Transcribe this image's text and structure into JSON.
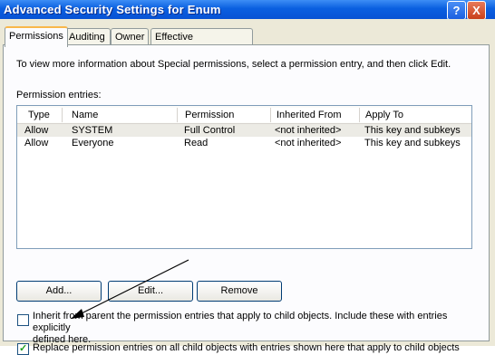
{
  "window": {
    "title": "Advanced Security Settings for Enum",
    "help_label": "?",
    "close_label": "X"
  },
  "tabs": [
    "Permissions",
    "Auditing",
    "Owner",
    "Effective Permissions"
  ],
  "permissions": {
    "info_text": "To view more information about Special permissions, select a permission entry, and then click Edit.",
    "entries_label": "Permission entries:",
    "columns": [
      "Type",
      "Name",
      "Permission",
      "Inherited From",
      "Apply To"
    ],
    "rows": [
      {
        "type": "Allow",
        "name": "SYSTEM",
        "permission": "Full Control",
        "inherited_from": "<not inherited>",
        "apply_to": "This key and subkeys"
      },
      {
        "type": "Allow",
        "name": "Everyone",
        "permission": "Read",
        "inherited_from": "<not inherited>",
        "apply_to": "This key and subkeys"
      }
    ],
    "buttons": {
      "add": "Add...",
      "edit": "Edit...",
      "remove": "Remove"
    },
    "inherit_line1": "Inherit from parent the permission entries that apply to child objects. Include these with entries explicitly",
    "inherit_line2": "defined here.",
    "inherit_checked": false,
    "replace_label": "Replace permission entries on all child objects with entries shown here that apply to child objects",
    "replace_checked": true
  }
}
